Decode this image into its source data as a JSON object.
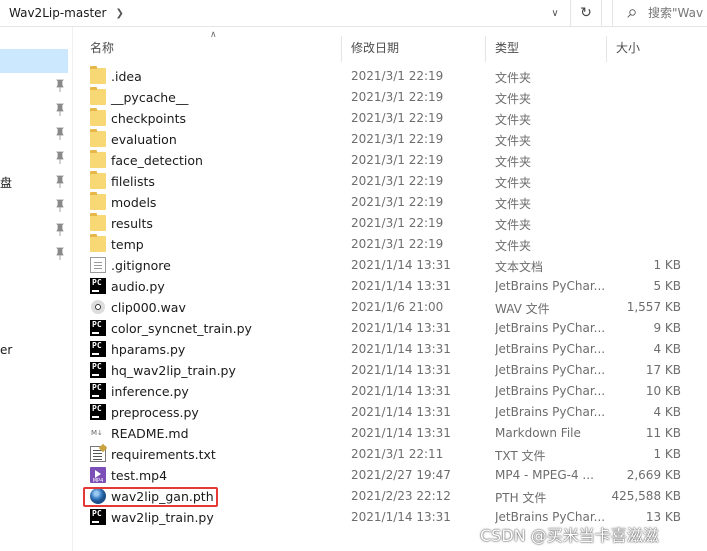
{
  "window": {
    "breadcrumb": "Wav2Lip-master",
    "search_placeholder": "搜索\"Wav"
  },
  "nav": {
    "fragments": [
      "盘",
      "er"
    ]
  },
  "columns": {
    "name": "名称",
    "modified": "修改日期",
    "type": "类型",
    "size": "大小"
  },
  "files": [
    {
      "name": ".idea",
      "modified": "2021/3/1 22:19",
      "type": "文件夹",
      "size": "",
      "icon": "folder-icon"
    },
    {
      "name": "__pycache__",
      "modified": "2021/3/1 22:19",
      "type": "文件夹",
      "size": "",
      "icon": "folder-icon"
    },
    {
      "name": "checkpoints",
      "modified": "2021/3/1 22:19",
      "type": "文件夹",
      "size": "",
      "icon": "folder-icon"
    },
    {
      "name": "evaluation",
      "modified": "2021/3/1 22:19",
      "type": "文件夹",
      "size": "",
      "icon": "folder-icon"
    },
    {
      "name": "face_detection",
      "modified": "2021/3/1 22:19",
      "type": "文件夹",
      "size": "",
      "icon": "folder-icon"
    },
    {
      "name": "filelists",
      "modified": "2021/3/1 22:19",
      "type": "文件夹",
      "size": "",
      "icon": "folder-icon"
    },
    {
      "name": "models",
      "modified": "2021/3/1 22:19",
      "type": "文件夹",
      "size": "",
      "icon": "folder-icon"
    },
    {
      "name": "results",
      "modified": "2021/3/1 22:19",
      "type": "文件夹",
      "size": "",
      "icon": "folder-icon"
    },
    {
      "name": "temp",
      "modified": "2021/3/1 22:19",
      "type": "文件夹",
      "size": "",
      "icon": "folder-icon"
    },
    {
      "name": ".gitignore",
      "modified": "2021/1/14 13:31",
      "type": "文本文档",
      "size": "1 KB",
      "icon": "text-file-icon"
    },
    {
      "name": "audio.py",
      "modified": "2021/1/14 13:31",
      "type": "JetBrains PyChar...",
      "size": "5 KB",
      "icon": "pycharm-file-icon"
    },
    {
      "name": "clip000.wav",
      "modified": "2021/1/6 21:00",
      "type": "WAV 文件",
      "size": "1,557 KB",
      "icon": "audio-file-icon"
    },
    {
      "name": "color_syncnet_train.py",
      "modified": "2021/1/14 13:31",
      "type": "JetBrains PyChar...",
      "size": "9 KB",
      "icon": "pycharm-file-icon"
    },
    {
      "name": "hparams.py",
      "modified": "2021/1/14 13:31",
      "type": "JetBrains PyChar...",
      "size": "4 KB",
      "icon": "pycharm-file-icon"
    },
    {
      "name": "hq_wav2lip_train.py",
      "modified": "2021/1/14 13:31",
      "type": "JetBrains PyChar...",
      "size": "17 KB",
      "icon": "pycharm-file-icon"
    },
    {
      "name": "inference.py",
      "modified": "2021/1/14 13:31",
      "type": "JetBrains PyChar...",
      "size": "10 KB",
      "icon": "pycharm-file-icon"
    },
    {
      "name": "preprocess.py",
      "modified": "2021/1/14 13:31",
      "type": "JetBrains PyChar...",
      "size": "4 KB",
      "icon": "pycharm-file-icon"
    },
    {
      "name": "README.md",
      "modified": "2021/1/14 13:31",
      "type": "Markdown File",
      "size": "11 KB",
      "icon": "markdown-file-icon"
    },
    {
      "name": "requirements.txt",
      "modified": "2021/3/1 22:11",
      "type": "TXT 文件",
      "size": "1 KB",
      "icon": "txt-file-icon"
    },
    {
      "name": "test.mp4",
      "modified": "2021/2/27 19:47",
      "type": "MP4 - MPEG-4 ...",
      "size": "2,669 KB",
      "icon": "mp4-file-icon"
    },
    {
      "name": "wav2lip_gan.pth",
      "modified": "2021/2/23 22:12",
      "type": "PTH 文件",
      "size": "425,588 KB",
      "icon": "pth-file-icon"
    },
    {
      "name": "wav2lip_train.py",
      "modified": "2021/1/14 13:31",
      "type": "JetBrains PyChar...",
      "size": "13 KB",
      "icon": "pycharm-file-icon"
    }
  ],
  "watermark": "CSDN @买米当卡喜滋滋"
}
